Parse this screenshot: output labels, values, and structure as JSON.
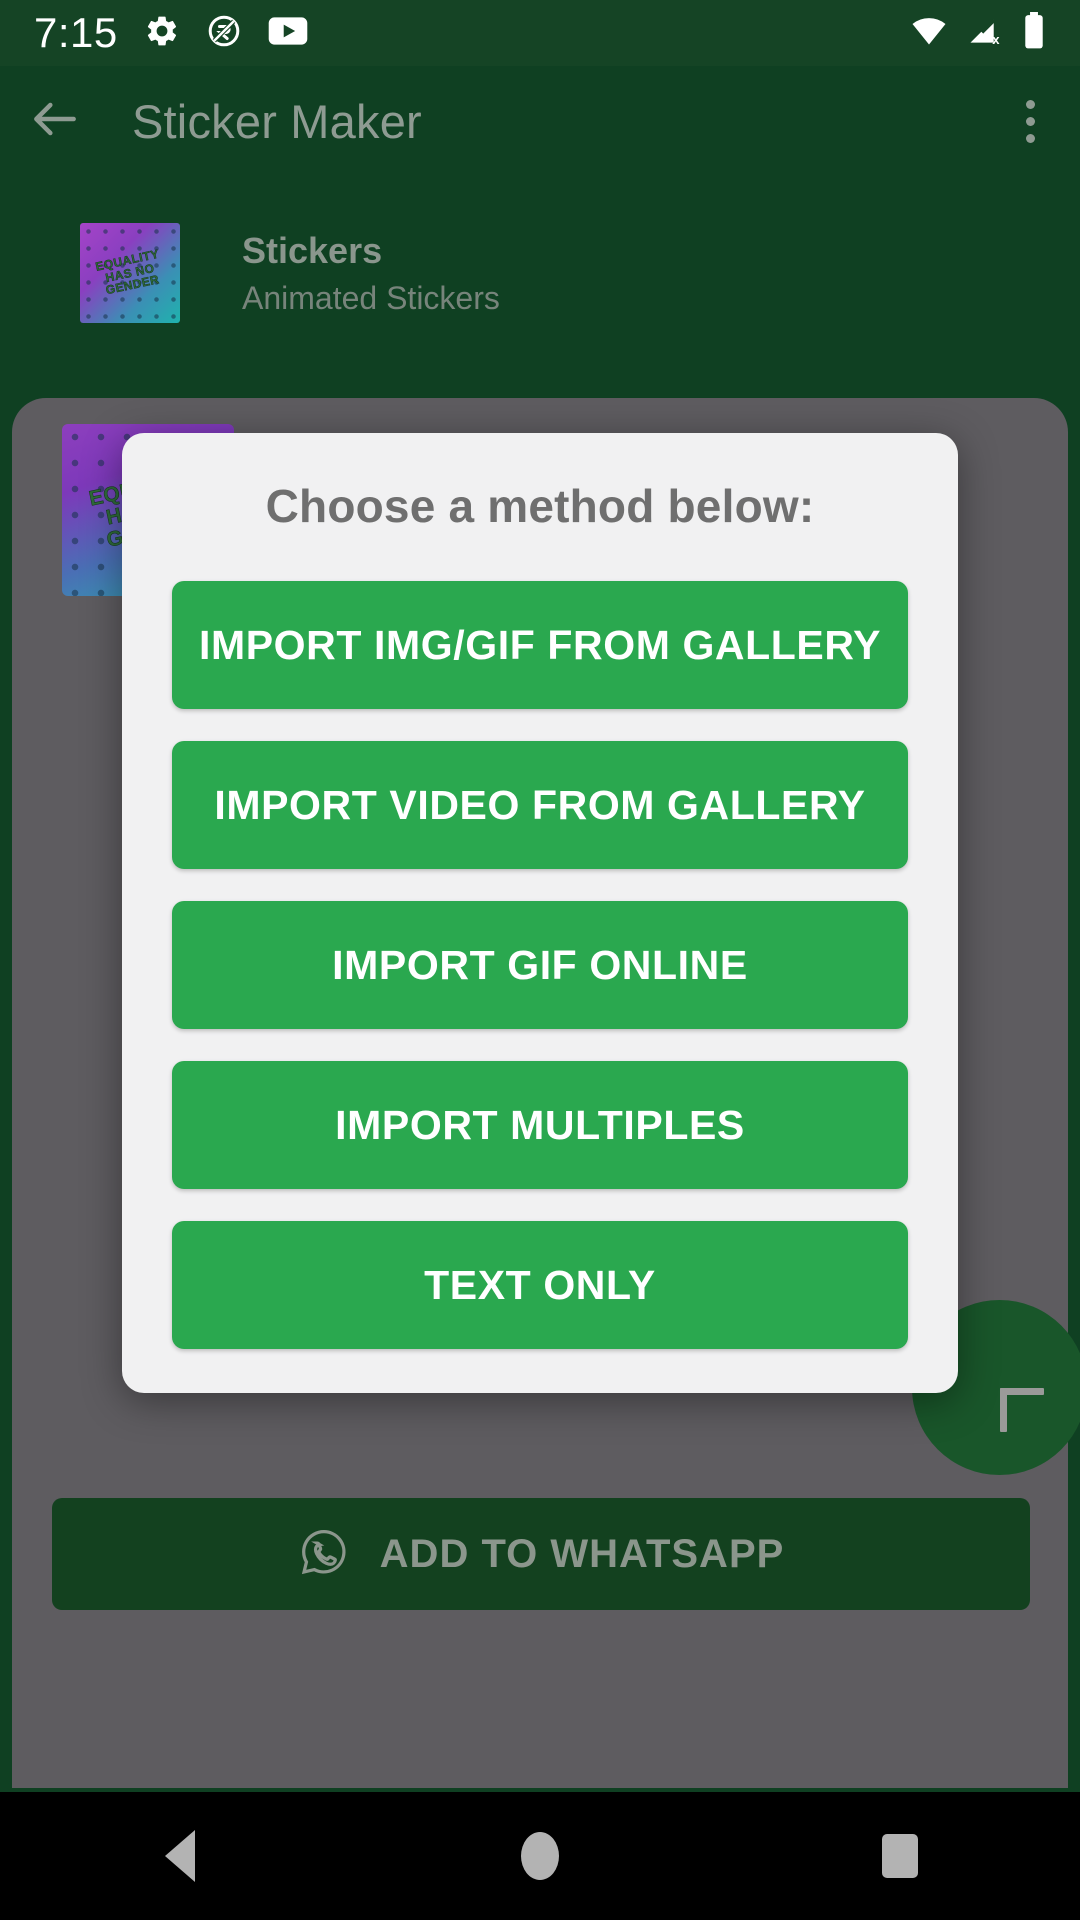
{
  "status_bar": {
    "time": "7:15",
    "left_icons": [
      "settings-gear-icon",
      "do-not-disturb-icon",
      "youtube-icon"
    ],
    "right_icons": [
      "wifi-icon",
      "cellular-no-sim-icon",
      "battery-icon"
    ],
    "background_color": "#154425"
  },
  "app_bar": {
    "back_icon": "back-arrow-icon",
    "title": "Sticker Maker",
    "overflow_icon": "overflow-menu-icon",
    "title_color": "#8e9b92"
  },
  "pack_row": {
    "title": "Stickers",
    "subtitle": "Animated Stickers",
    "thumbnail_text": [
      "EQUALITY",
      "HAS NO",
      "GENDER"
    ]
  },
  "fab": {
    "icon": "plus-icon",
    "color": "#19562a"
  },
  "whatsapp_button": {
    "icon": "whatsapp-icon",
    "label": "ADD TO WHATSAPP",
    "color": "#13411f"
  },
  "dialog": {
    "title": "Choose a method below:",
    "background_color": "#f1f1f2",
    "button_color": "#2aa84f",
    "buttons": [
      {
        "label": "IMPORT IMG/GIF FROM GALLERY",
        "name": "import-img-gif-from-gallery-button"
      },
      {
        "label": "IMPORT VIDEO FROM GALLERY",
        "name": "import-video-from-gallery-button"
      },
      {
        "label": "IMPORT GIF ONLINE",
        "name": "import-gif-online-button"
      },
      {
        "label": "IMPORT MULTIPLES",
        "name": "import-multiples-button"
      },
      {
        "label": "TEXT ONLY",
        "name": "text-only-button"
      }
    ]
  },
  "nav_bar": {
    "back_icon": "nav-back-icon",
    "home_icon": "nav-home-icon",
    "recents_icon": "nav-recents-icon",
    "background_color": "#000000"
  }
}
